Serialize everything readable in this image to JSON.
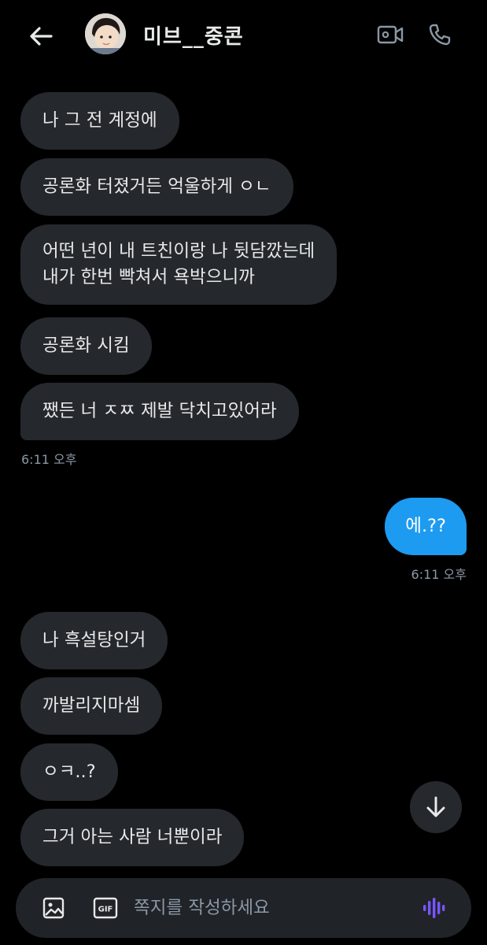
{
  "header": {
    "title": "미브__중콘",
    "back_icon": "arrow-left-icon",
    "video_icon": "video-call-icon",
    "phone_icon": "phone-icon"
  },
  "messages": {
    "r1": "나 그 전 계정에",
    "r2": "공론화 터졌거든 억울하게 ㅇㄴ",
    "r3_line1": "어떤 년이 내 트친이랑 나 뒷담깠는데",
    "r3_line2": "내가 한번 빡쳐서 욕박으니까",
    "r4": "공론화 시킴",
    "r5": "쨌든 너 ㅈㅉ 제발 닥치고있어라",
    "time1": "6:11 오후",
    "s1": "에.??",
    "time2": "6:11 오후",
    "r6": "나 흑설탕인거",
    "r7": "까발리지마셈",
    "r8": "ㅇㅋ..?",
    "r9": "그거 아는 사람 너뿐이라"
  },
  "composer": {
    "placeholder": "쪽지를 작성하세요",
    "gif_label": "GIF"
  },
  "colors": {
    "background": "#000000",
    "received_bubble": "#25282c",
    "sent_bubble": "#1d9bf0",
    "voice_accent": "#7856ff",
    "muted_text": "#8b98a5"
  }
}
